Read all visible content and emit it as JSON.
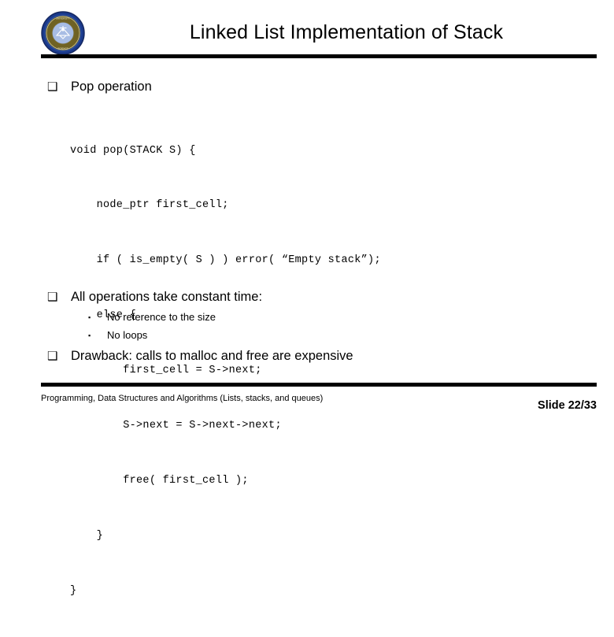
{
  "slide": {
    "title": "Linked List Implementation of Stack",
    "logo": {
      "name": "university-seal-logo",
      "outer_ring_color": "#1b3a8c",
      "band_color": "#7a6a28",
      "center_color": "#8fa8d8",
      "emblem_color": "#ffffff"
    },
    "rule_color": "#000000",
    "bullets": {
      "pop_operation": {
        "marker": "hollow-square",
        "marker_glyph": "❑",
        "label": "Pop operation"
      },
      "all_operations": {
        "marker": "hollow-square",
        "marker_glyph": "❑",
        "label": "All operations take constant time:"
      },
      "no_reference": {
        "marker": "filled-small-square",
        "marker_glyph": "▪",
        "label": "No reference to the size"
      },
      "no_loops": {
        "marker": "filled-small-square",
        "marker_glyph": "▪",
        "label": "No loops"
      },
      "drawback": {
        "marker": "hollow-square",
        "marker_glyph": "❑",
        "label": "Drawback: calls to malloc and free are expensive"
      }
    },
    "code": {
      "language": "C",
      "lines": [
        "void pop(STACK S) {",
        "    node_ptr first_cell;",
        "    if ( is_empty( S ) ) error( “Empty stack”);",
        "    else {",
        "        first_cell = S->next;",
        "        S->next = S->next->next;",
        "        free( first_cell );",
        "    }",
        "}"
      ]
    },
    "footer": {
      "course": "Programming, Data Structures and Algorithms  (Lists, stacks, and queues)",
      "slide_number": "Slide 22/33"
    }
  }
}
